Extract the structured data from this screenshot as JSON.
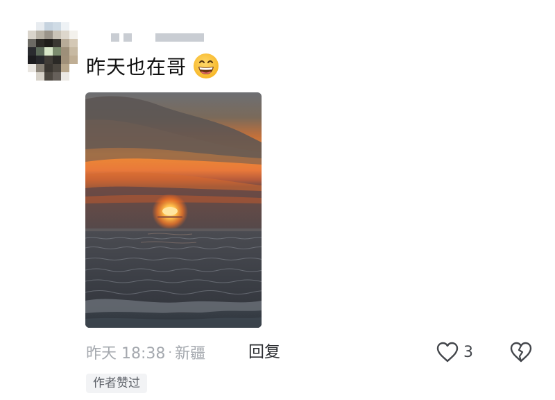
{
  "comment": {
    "text": "昨天也在哥",
    "emoji": "grinning-face-emoji"
  },
  "photo": {
    "description_icon": "sunset-over-sea-photo"
  },
  "meta": {
    "time": "昨天 18:38",
    "separator": "·",
    "location": "新疆"
  },
  "actions": {
    "reply_label": "回复",
    "like_icon": "heart-outline-icon",
    "like_count": "3",
    "dislike_icon": "broken-heart-icon"
  },
  "badge": {
    "label": "作者赞过"
  },
  "colors": {
    "text_primary": "#111111",
    "text_secondary": "#a4a8ae",
    "badge_bg": "#f2f3f5"
  }
}
